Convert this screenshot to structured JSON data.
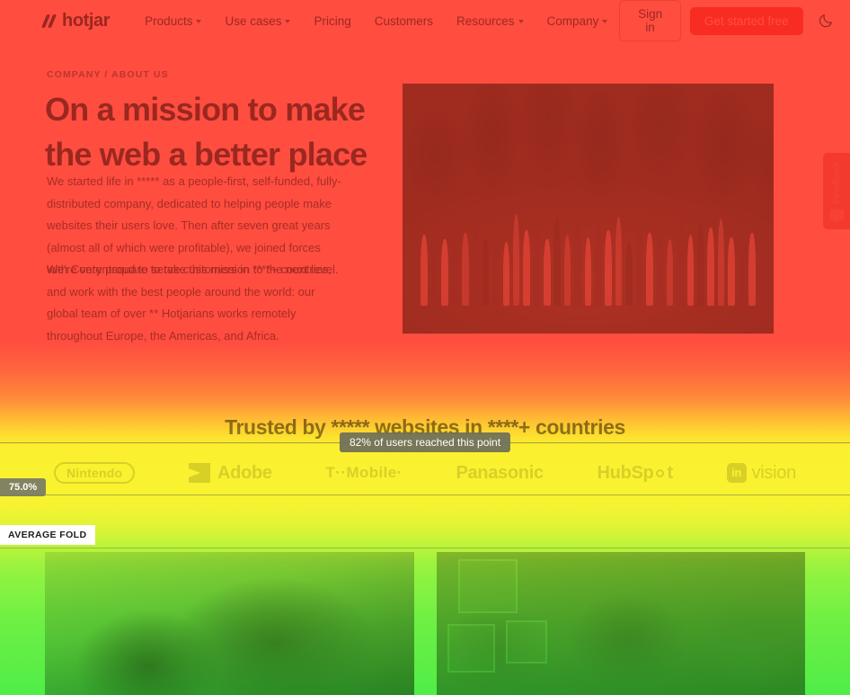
{
  "nav": {
    "brand": "hotjar",
    "links": [
      {
        "label": "Products",
        "has_caret": true
      },
      {
        "label": "Use cases",
        "has_caret": true
      },
      {
        "label": "Pricing",
        "has_caret": false
      },
      {
        "label": "Customers",
        "has_caret": false
      },
      {
        "label": "Resources",
        "has_caret": true
      },
      {
        "label": "Company",
        "has_caret": true
      }
    ],
    "sign_in": "Sign in",
    "cta": "Get started free",
    "theme_toggle_icon": "moon-icon"
  },
  "hero": {
    "eyebrow": "COMPANY / ABOUT US",
    "title_line1": "On a mission to make",
    "title_line2": "the web a better place",
    "paragraph1": "We started life in ***** as a people-first, self-funded, fully-distributed company, dedicated to helping people make websites their users love. Then after seven great years (almost all of which were profitable), we joined forces with Contentsquare to take this mission to the next level.",
    "paragraph2": "We're very proud to serve customers in ****+ countries, and work with the best people around the world: our global team of over ** Hotjarians works remotely throughout Europe, the Americas, and Africa.",
    "photo_alt": "Large group of Hotjar team members outdoors"
  },
  "trusted": {
    "title": "Trusted by ***** websites in ****+ countries",
    "logos": [
      {
        "name": "Nintendo",
        "text": "Nintendo"
      },
      {
        "name": "Adobe",
        "text": "Adobe"
      },
      {
        "name": "T-Mobile",
        "text": "T··Mobile·"
      },
      {
        "name": "Panasonic",
        "text": "Panasonic"
      },
      {
        "name": "HubSpot",
        "text": "HubSp"
      },
      {
        "name": "HubSpot2",
        "text": "t"
      },
      {
        "name": "InVision",
        "text": "vision",
        "mark": "in"
      }
    ]
  },
  "cards": [
    {
      "alt": "Two Hotjar teammates working together at a laptop"
    },
    {
      "alt": "Hotjar team members gathered in a living room"
    }
  ],
  "heatmap": {
    "tooltip": "82% of users reached this point",
    "percent_badge": "75.0%",
    "fold_label": "AVERAGE FOLD",
    "colors": {
      "hot": "#ff4438",
      "warm": "#ff8a2e",
      "mid": "#ffe81f",
      "cool": "#3cec3a",
      "marker_bg": "#6c6e5c",
      "fold_bg": "#ffffff"
    }
  },
  "feedback_widget": {
    "label": "Feedback",
    "icon": "comment-icon"
  }
}
